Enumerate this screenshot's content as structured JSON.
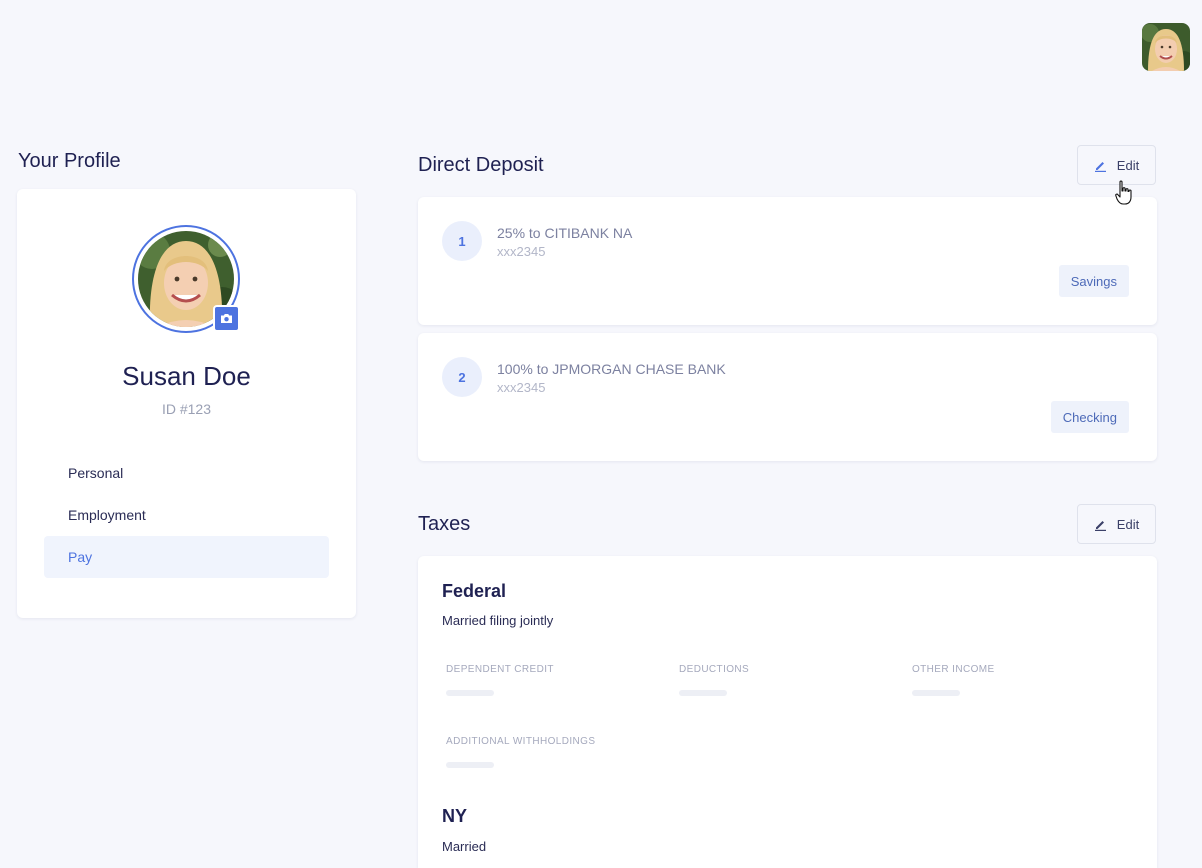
{
  "profile": {
    "section_title": "Your Profile",
    "name": "Susan Doe",
    "id": "ID #123",
    "nav": [
      {
        "label": "Personal",
        "active": false
      },
      {
        "label": "Employment",
        "active": false
      },
      {
        "label": "Pay",
        "active": true
      }
    ]
  },
  "direct_deposit": {
    "title": "Direct Deposit",
    "edit_label": "Edit",
    "accounts": [
      {
        "number": "1",
        "line": "25% to CITIBANK NA",
        "account": "xxx2345",
        "type": "Savings"
      },
      {
        "number": "2",
        "line": "100% to JPMORGAN CHASE BANK",
        "account": "xxx2345",
        "type": "Checking"
      }
    ]
  },
  "taxes": {
    "title": "Taxes",
    "edit_label": "Edit",
    "federal": {
      "heading": "Federal",
      "status": "Married filing jointly",
      "fields": [
        "Dependent credit",
        "Deductions",
        "Other income",
        "Additional withholdings"
      ]
    },
    "state": {
      "heading": "NY",
      "status": "Married"
    }
  },
  "colors": {
    "accent": "#4d73e0",
    "background": "#f6f7fc",
    "text": "#1f2152"
  },
  "icons": {
    "edit": "pencil-icon",
    "camera": "camera-icon",
    "cursor": "hand-pointer-cursor"
  }
}
